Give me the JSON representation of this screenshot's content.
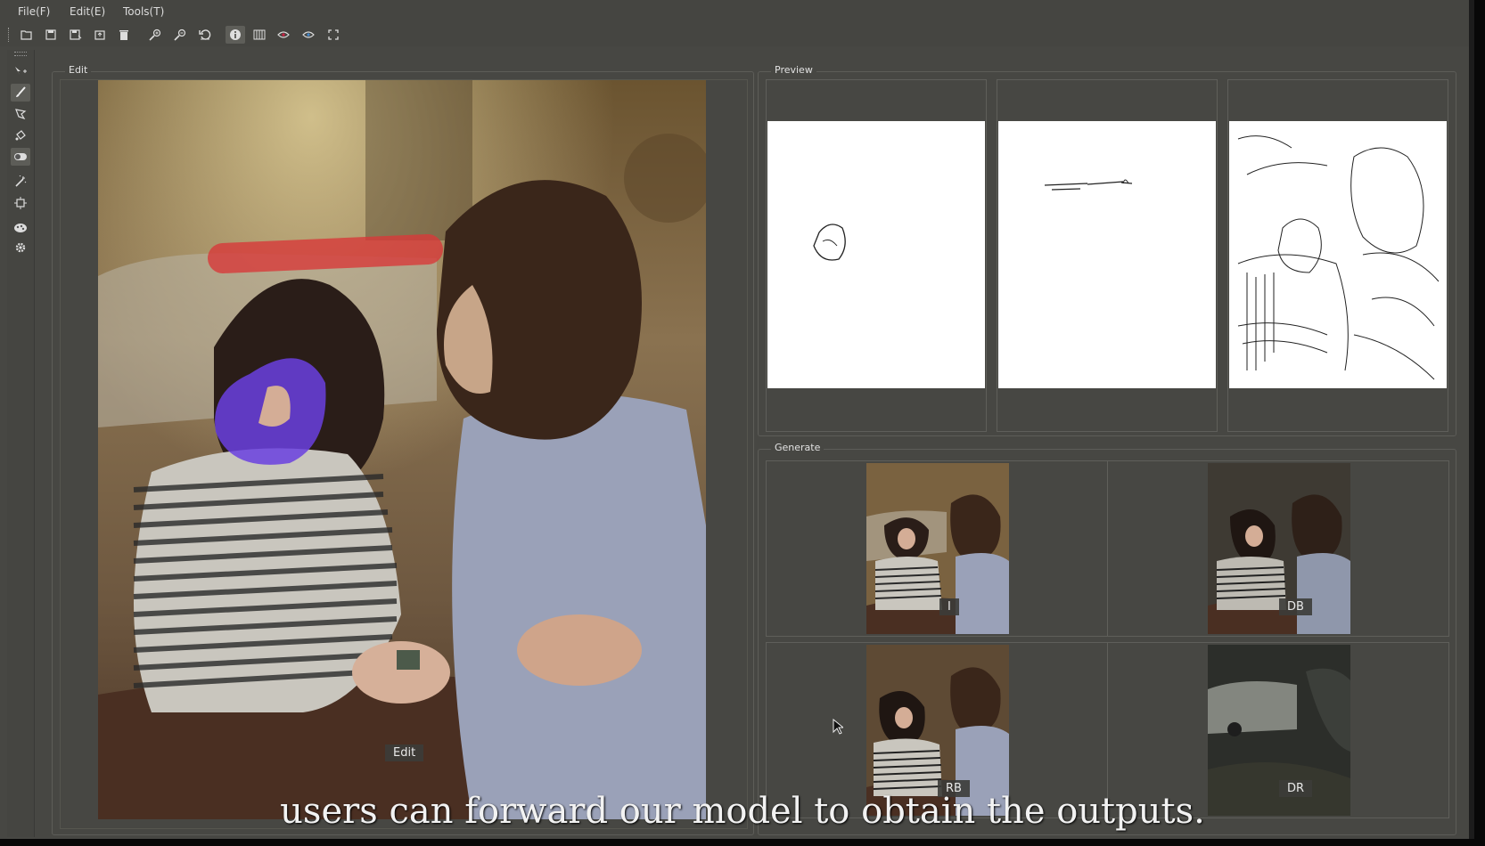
{
  "menu": {
    "file": "File(F)",
    "edit": "Edit(E)",
    "tools": "Tools(T)"
  },
  "toolbar_icons": [
    "open-icon",
    "save-icon",
    "save-as-icon",
    "export-icon",
    "delete-icon",
    "zoom-in-icon",
    "zoom-out-icon",
    "reset-icon",
    "info-icon",
    "grid-icon",
    "eye-icon",
    "eye-alt-icon",
    "fullscreen-icon"
  ],
  "edit_group": {
    "title": "Edit",
    "canvas_label": "Edit"
  },
  "preview_group": {
    "title": "Preview"
  },
  "generate_group": {
    "title": "Generate",
    "labels": [
      "I",
      "DB",
      "RB",
      "DR"
    ]
  },
  "caption": "users can forward our model to obtain the outputs."
}
